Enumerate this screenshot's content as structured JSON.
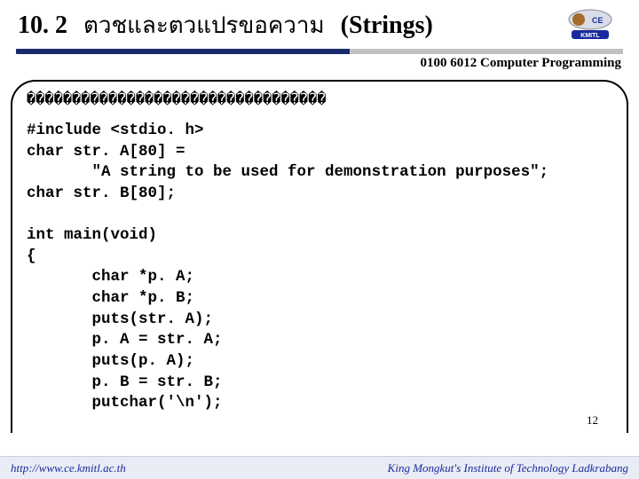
{
  "header": {
    "section_number": "10. 2",
    "title_thai": "ตวชและตวแปรขอความ",
    "title_en": "(Strings)",
    "course_code": "0100 6012 Computer Programming"
  },
  "content": {
    "squares": "���������������������������������",
    "code": "#include <stdio. h>\nchar str. A[80] =\n       \"A string to be used for demonstration purposes\";\nchar str. B[80];\n\nint main(void)\n{\n       char *p. A;\n       char *p. B;\n       puts(str. A);\n       p. A = str. A;\n       puts(p. A);\n       p. B = str. B;\n       putchar('\\n');"
  },
  "page_number": "12",
  "footer": {
    "url": "http://www.ce.kmitl.ac.th",
    "institute": "King Mongkut's Institute of Technology Ladkrabang"
  }
}
